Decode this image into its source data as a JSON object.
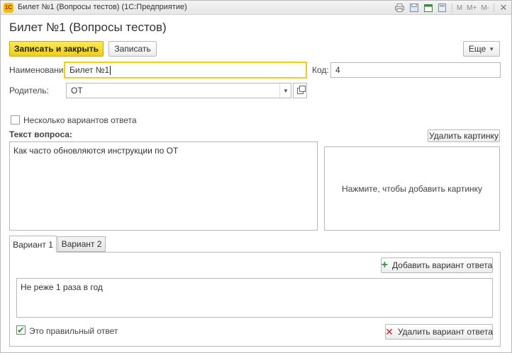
{
  "window": {
    "title": "Билет №1 (Вопросы тестов)  (1С:Предприятие)",
    "toolbar": {
      "m": "M",
      "m_plus": "M+",
      "m_minus": "M-"
    }
  },
  "form": {
    "heading": "Билет №1 (Вопросы тестов)",
    "save_close_label": "Записать и закрыть",
    "save_label": "Записать",
    "more_label": "Еще",
    "name_label": "Наименование:",
    "name_value": "Билет №1",
    "code_label": "Код:",
    "code_value": "4",
    "parent_label": "Родитель:",
    "parent_value": "ОТ",
    "multi_label": "Несколько вариантов ответа",
    "multi_checked": false,
    "question_label": "Текст вопроса:",
    "delete_picture_label": "Удалить картинку",
    "question_text": "Как часто обновляются инструкции по ОТ",
    "picture_placeholder": "Нажмите, чтобы добавить картинку"
  },
  "tabs": [
    {
      "label": "Вариант 1",
      "active": true
    },
    {
      "label": "Вариант 2",
      "active": false
    }
  ],
  "variant": {
    "add_label": "Добавить вариант ответа",
    "answer_text": "Не реже 1 раза в год",
    "correct_label": "Это правильный ответ",
    "correct_checked": true,
    "delete_label": "Удалить вариант ответа"
  },
  "colors": {
    "primary_button": "#f0cf10",
    "focus_border": "#f0cf10",
    "add_icon": "#2b9a3a",
    "delete_icon": "#d0202a"
  }
}
